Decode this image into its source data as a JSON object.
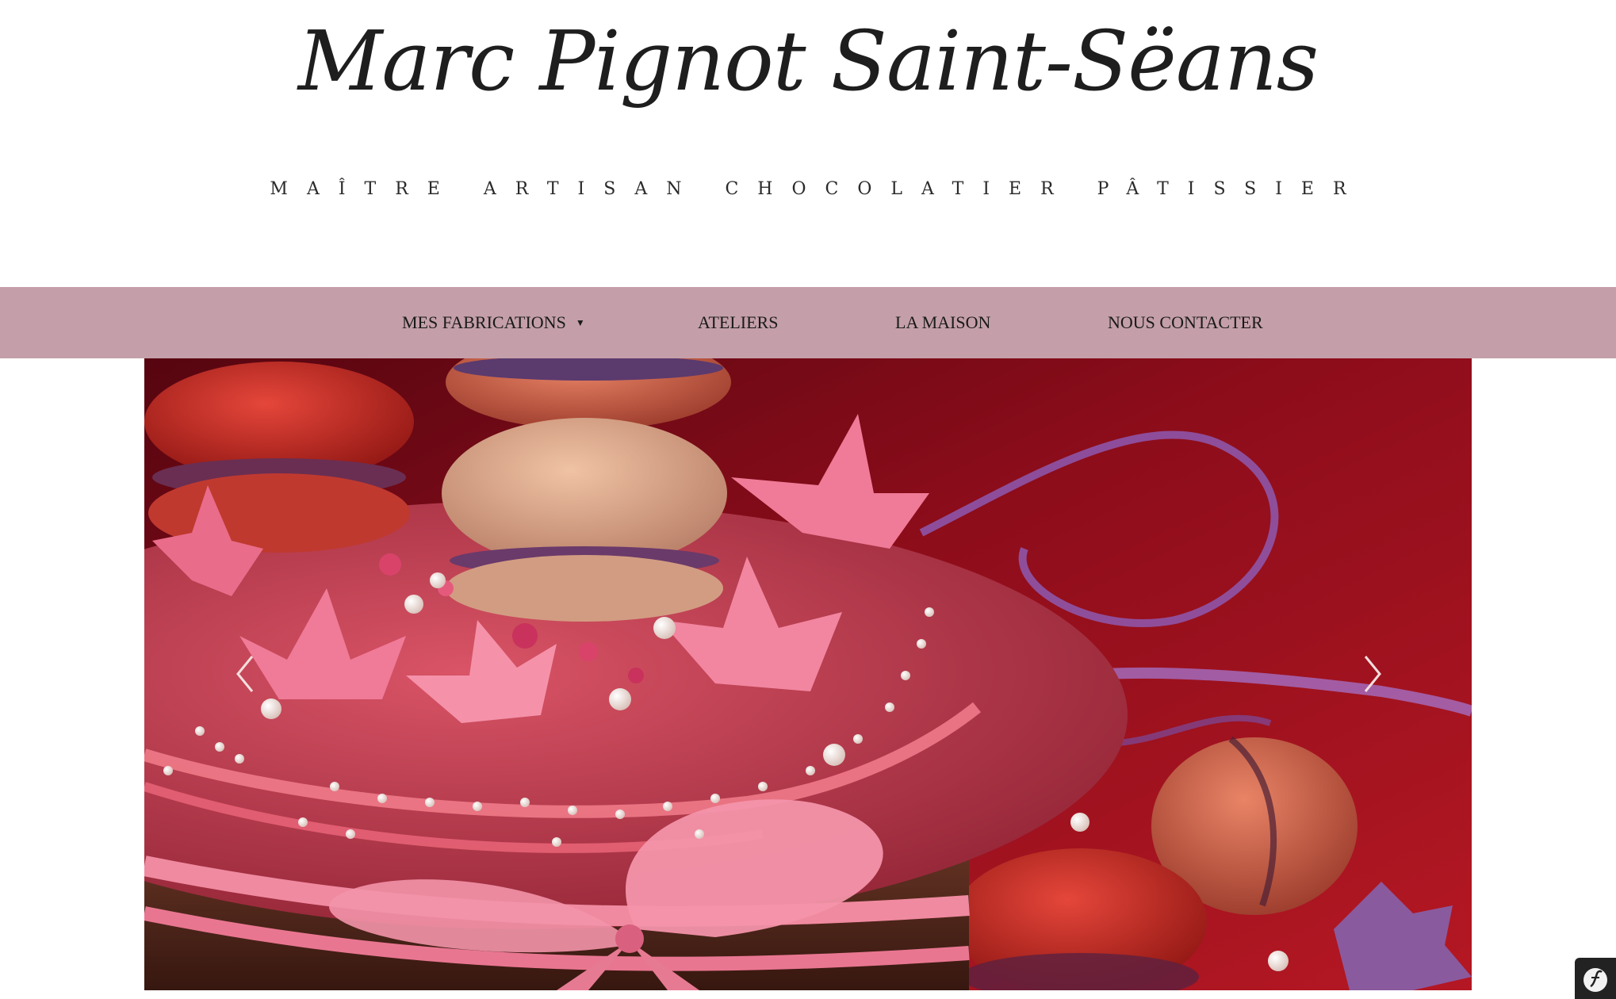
{
  "header": {
    "brand_title": "Marc Pignot Saint-Sëans",
    "tagline": "MAÎTRE ARTISAN CHOCOLATIER PÂTISSIER"
  },
  "nav": {
    "items": [
      {
        "label": "MES FABRICATIONS",
        "has_dropdown": true
      },
      {
        "label": "ATELIERS"
      },
      {
        "label": "LA MAISON"
      },
      {
        "label": "NOUS CONTACTER"
      }
    ],
    "background": "#c49fa9"
  },
  "carousel": {
    "slide_subject": "macarons-cake",
    "prev_icon": "chevron-left-icon",
    "next_icon": "chevron-right-icon"
  },
  "toolbar_badge": {
    "icon": "symfony-icon"
  }
}
